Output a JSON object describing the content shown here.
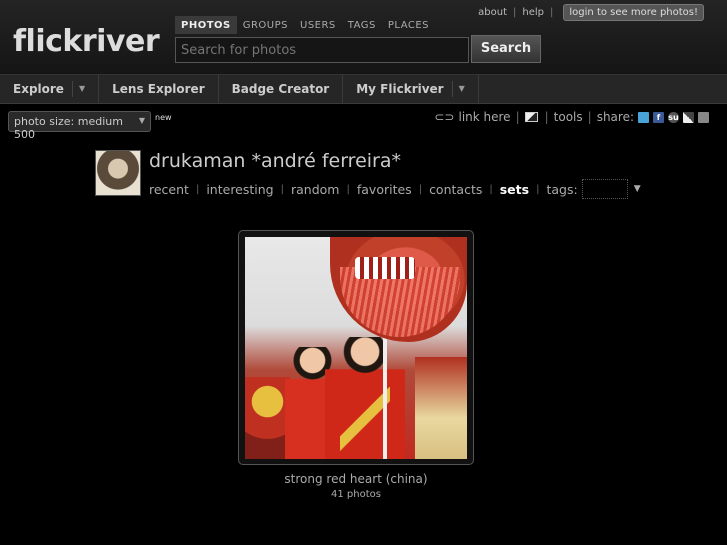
{
  "header": {
    "logo": "flickriver",
    "toplinks": {
      "about": "about",
      "help": "help",
      "login": "login to see more photos!",
      "sep": "|"
    },
    "search_tabs": [
      "PHOTOS",
      "GROUPS",
      "USERS",
      "TAGS",
      "PLACES"
    ],
    "search_placeholder": "Search for photos",
    "search_button": "Search"
  },
  "nav": {
    "items": [
      {
        "label": "Explore",
        "has_dropdown": true
      },
      {
        "label": "Lens Explorer",
        "has_dropdown": false
      },
      {
        "label": "Badge Creator",
        "has_dropdown": false
      },
      {
        "label": "My Flickriver",
        "has_dropdown": true
      }
    ]
  },
  "toolbar": {
    "photo_size": "photo size: medium 500",
    "new_badge": "new",
    "link_here": "link here",
    "tools": "tools",
    "share": "share:",
    "share_su": "su"
  },
  "user": {
    "name": "drukaman *andré ferreira*",
    "nav": [
      "recent",
      "interesting",
      "random",
      "favorites",
      "contacts",
      "sets",
      "tags:"
    ],
    "active": "sets"
  },
  "photo": {
    "title": "strong red heart (china)",
    "count": "41 photos"
  },
  "colors": {
    "background": "#000000",
    "header": "#1c1c1c",
    "nav": "#262626",
    "text": "#cccccc"
  }
}
